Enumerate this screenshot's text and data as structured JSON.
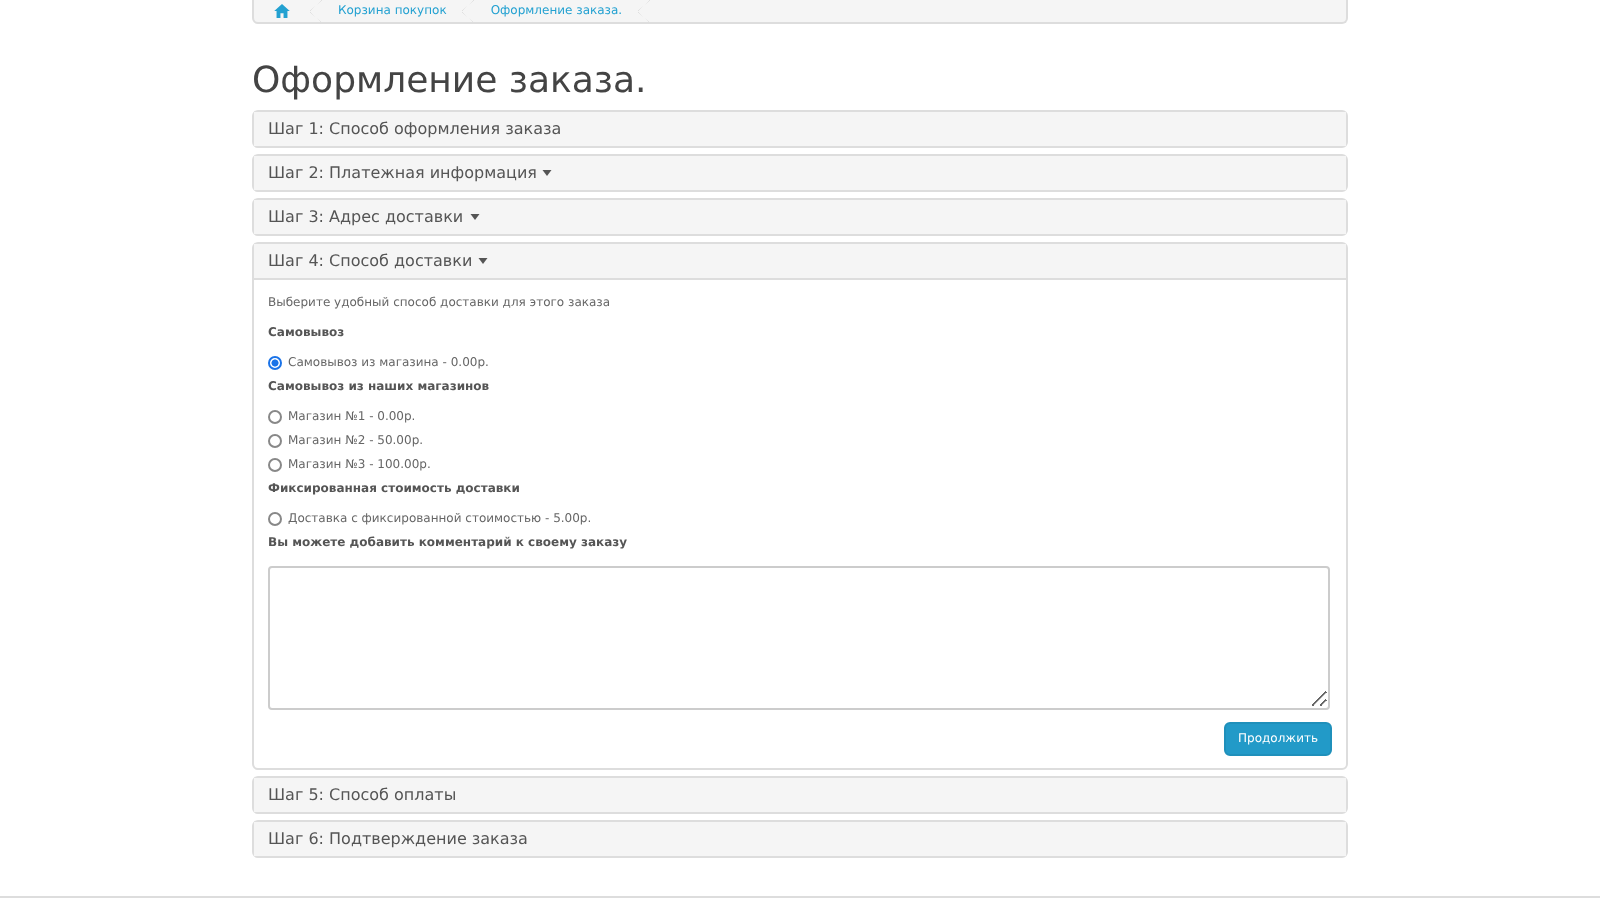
{
  "breadcrumb": [
    {
      "label": "Корзина покупок"
    },
    {
      "label": "Оформление заказа."
    }
  ],
  "title": "Оформление заказа.",
  "steps": [
    {
      "title": "Шаг 1: Способ оформления заказа",
      "caret": false,
      "expanded": false
    },
    {
      "title": "Шаг 2: Платежная информация",
      "caret": true,
      "expanded": false
    },
    {
      "title": "Шаг 3: Адрес доставки",
      "caret": true,
      "expanded": false
    },
    {
      "title": "Шаг 4: Способ доставки",
      "caret": true,
      "expanded": true,
      "intro": "Выберите удобный способ доставки для этого заказа",
      "groups": [
        {
          "heading": "Самовывоз",
          "options": [
            {
              "label": "Самовывоз из магазина - 0.00р.",
              "selected": true
            }
          ]
        },
        {
          "heading": "Самовывоз из наших магазинов",
          "options": [
            {
              "label": "Магазин №1 - 0.00р.",
              "selected": false
            },
            {
              "label": "Магазин №2 - 50.00р.",
              "selected": false
            },
            {
              "label": "Магазин №3 - 100.00р.",
              "selected": false
            }
          ]
        },
        {
          "heading": "Фиксированная стоимость доставки",
          "options": [
            {
              "label": "Доставка с фиксированной стоимостью - 5.00р.",
              "selected": false
            }
          ]
        }
      ],
      "comment_label": "Вы можете добавить комментарий к своему заказу",
      "button": "Продолжить"
    },
    {
      "title": "Шаг 5: Способ оплаты",
      "caret": false,
      "expanded": false
    },
    {
      "title": "Шаг 6: Подтверждение заказа",
      "caret": false,
      "expanded": false
    }
  ]
}
